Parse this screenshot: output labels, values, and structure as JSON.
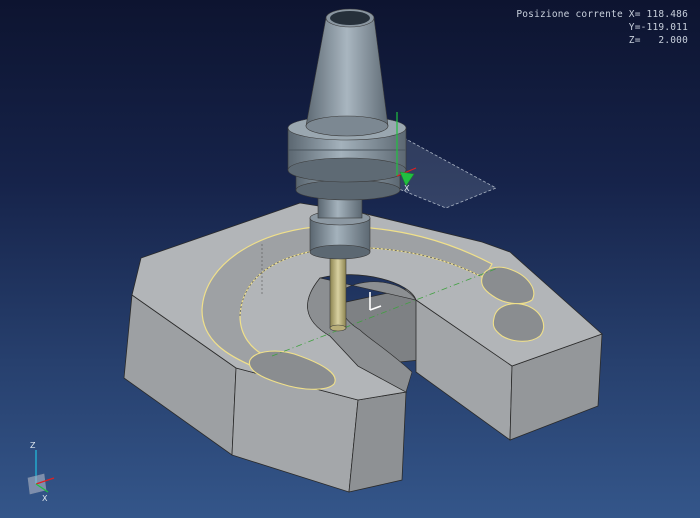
{
  "readout": {
    "label": "Posizione corrente",
    "x": "X= 118.486",
    "y": "Y=-119.011",
    "z": "Z=   2.000"
  },
  "triad": {
    "z_label": "Z",
    "x_label": "X"
  },
  "colors": {
    "background_top": "#0d1430",
    "background_bottom": "#34568a",
    "part_face": "#a9acae",
    "toolpath": "#f0e08a",
    "axis_x": "#e02020",
    "axis_y": "#20c040",
    "axis_z": "#20c0e0"
  }
}
